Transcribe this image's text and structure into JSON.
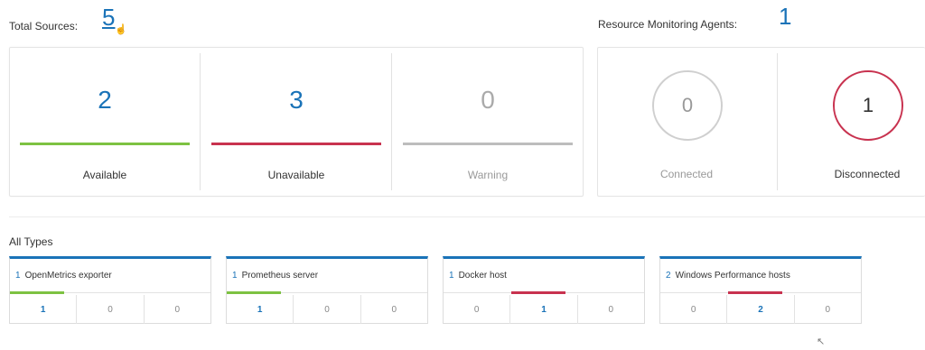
{
  "header": {
    "total_sources_label": "Total Sources:",
    "total_sources_count": "5",
    "rma_label": "Resource Monitoring Agents:",
    "rma_count": "1"
  },
  "status": [
    {
      "value": "2",
      "label": "Available",
      "color": "#7dc242"
    },
    {
      "value": "3",
      "label": "Unavailable",
      "color": "#c8324f"
    },
    {
      "value": "0",
      "label": "Warning",
      "color": "#bdbdbd"
    }
  ],
  "agents": [
    {
      "value": "0",
      "label": "Connected",
      "ring_color": "#cfcfcf"
    },
    {
      "value": "1",
      "label": "Disconnected",
      "ring_color": "#c8324f"
    }
  ],
  "all_types_label": "All Types",
  "types": [
    {
      "count": "1",
      "name": "OpenMetrics exporter",
      "cells": [
        "1",
        "0",
        "0"
      ],
      "active": 0,
      "highlight_color": "#7dc242"
    },
    {
      "count": "1",
      "name": "Prometheus server",
      "cells": [
        "1",
        "0",
        "0"
      ],
      "active": 0,
      "highlight_color": "#7dc242"
    },
    {
      "count": "1",
      "name": "Docker host",
      "cells": [
        "0",
        "1",
        "0"
      ],
      "active": 1,
      "highlight_color": "#c8324f"
    },
    {
      "count": "2",
      "name": "Windows Performance hosts",
      "cells": [
        "0",
        "2",
        "0"
      ],
      "active": 1,
      "highlight_color": "#c8324f"
    }
  ],
  "colors": {
    "accent": "#1a73b8"
  }
}
